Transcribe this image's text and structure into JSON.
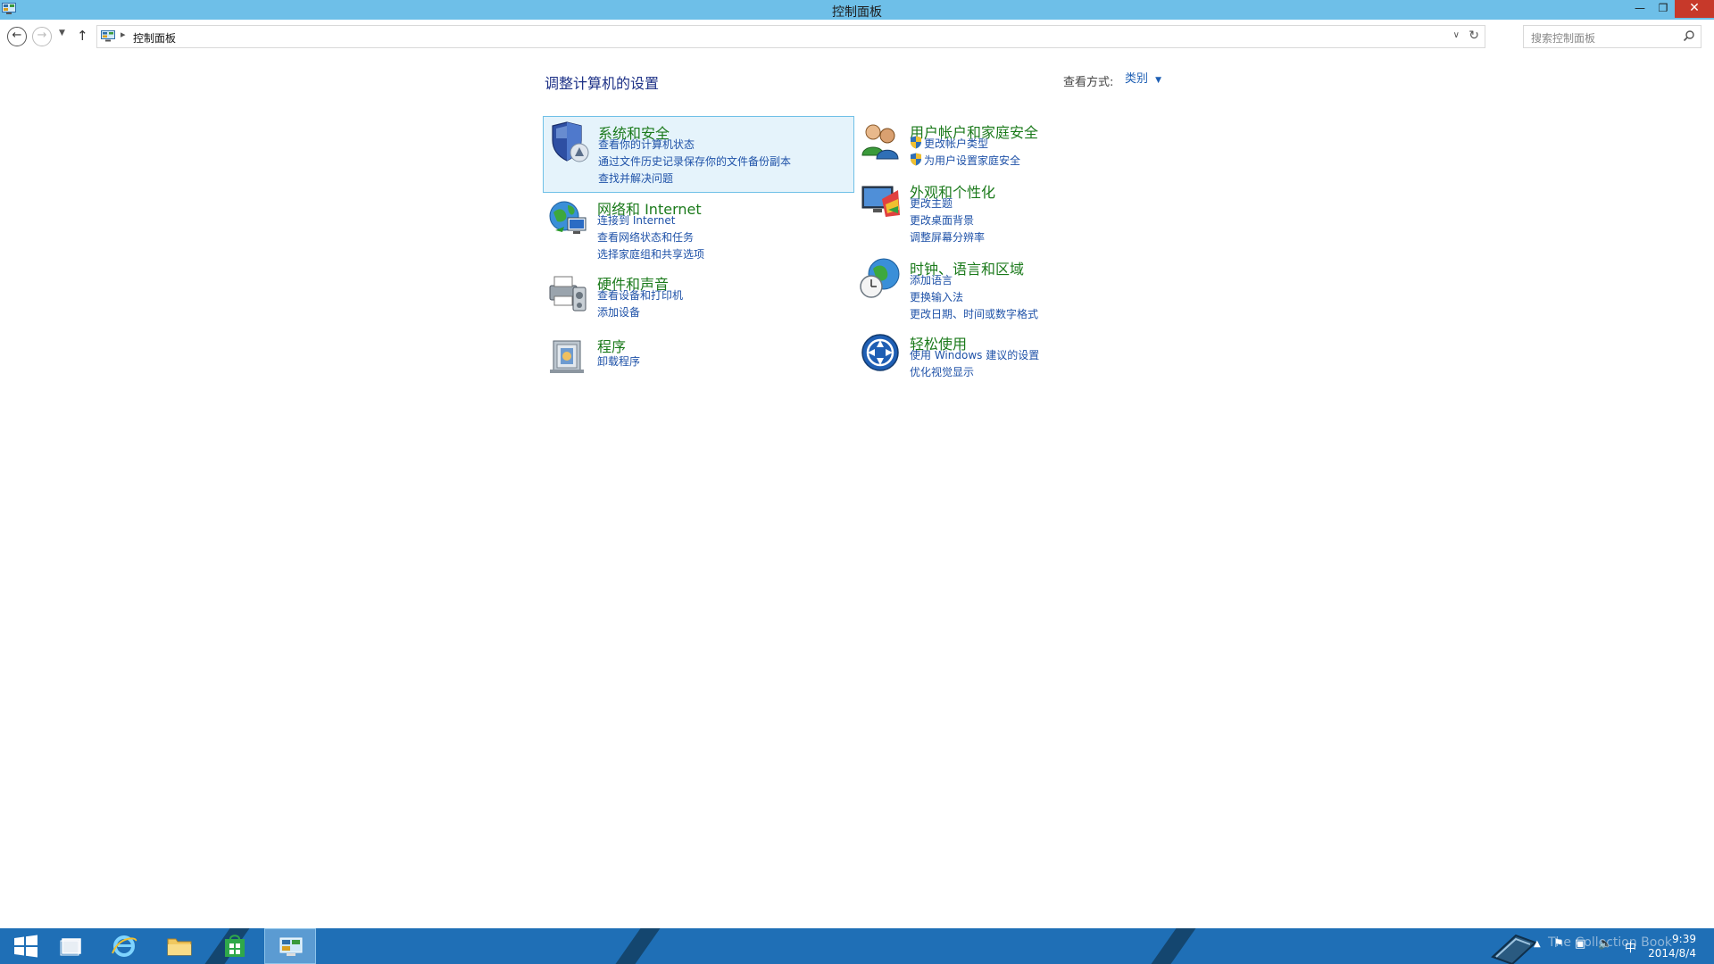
{
  "window": {
    "title": "控制面板"
  },
  "address_bar": {
    "crumb": "控制面板"
  },
  "search": {
    "placeholder": "搜索控制面板"
  },
  "content": {
    "heading": "调整计算机的设置",
    "view_by_label": "查看方式:",
    "view_by_value": "类别"
  },
  "categories": {
    "system": {
      "title": "系统和安全",
      "links": [
        "查看你的计算机状态",
        "通过文件历史记录保存你的文件备份副本",
        "查找并解决问题"
      ]
    },
    "network": {
      "title": "网络和 Internet",
      "links": [
        "连接到 Internet",
        "查看网络状态和任务",
        "选择家庭组和共享选项"
      ]
    },
    "hardware": {
      "title": "硬件和声音",
      "links": [
        "查看设备和打印机",
        "添加设备"
      ]
    },
    "programs": {
      "title": "程序",
      "links": [
        "卸载程序"
      ]
    },
    "users": {
      "title": "用户帐户和家庭安全",
      "links": [
        "更改帐户类型",
        "为用户设置家庭安全"
      ]
    },
    "appearance": {
      "title": "外观和个性化",
      "links": [
        "更改主题",
        "更改桌面背景",
        "调整屏幕分辨率"
      ]
    },
    "clock": {
      "title": "时钟、语言和区域",
      "links": [
        "添加语言",
        "更换输入法",
        "更改日期、时间或数字格式"
      ]
    },
    "ease": {
      "title": "轻松使用",
      "links": [
        "使用 Windows 建议的设置",
        "优化视觉显示"
      ]
    }
  },
  "taskbar": {
    "tray_input": "中",
    "time": "9:39",
    "date": "2014/8/4",
    "watermark": "The Collection Book"
  },
  "colors": {
    "titlebar": "#6ebfe8",
    "category_title": "#1b7a1b",
    "link": "#1f52a8",
    "heading": "#1e3287",
    "taskbar": "#1f6fb6",
    "selection_bg": "#e5f3fb"
  }
}
